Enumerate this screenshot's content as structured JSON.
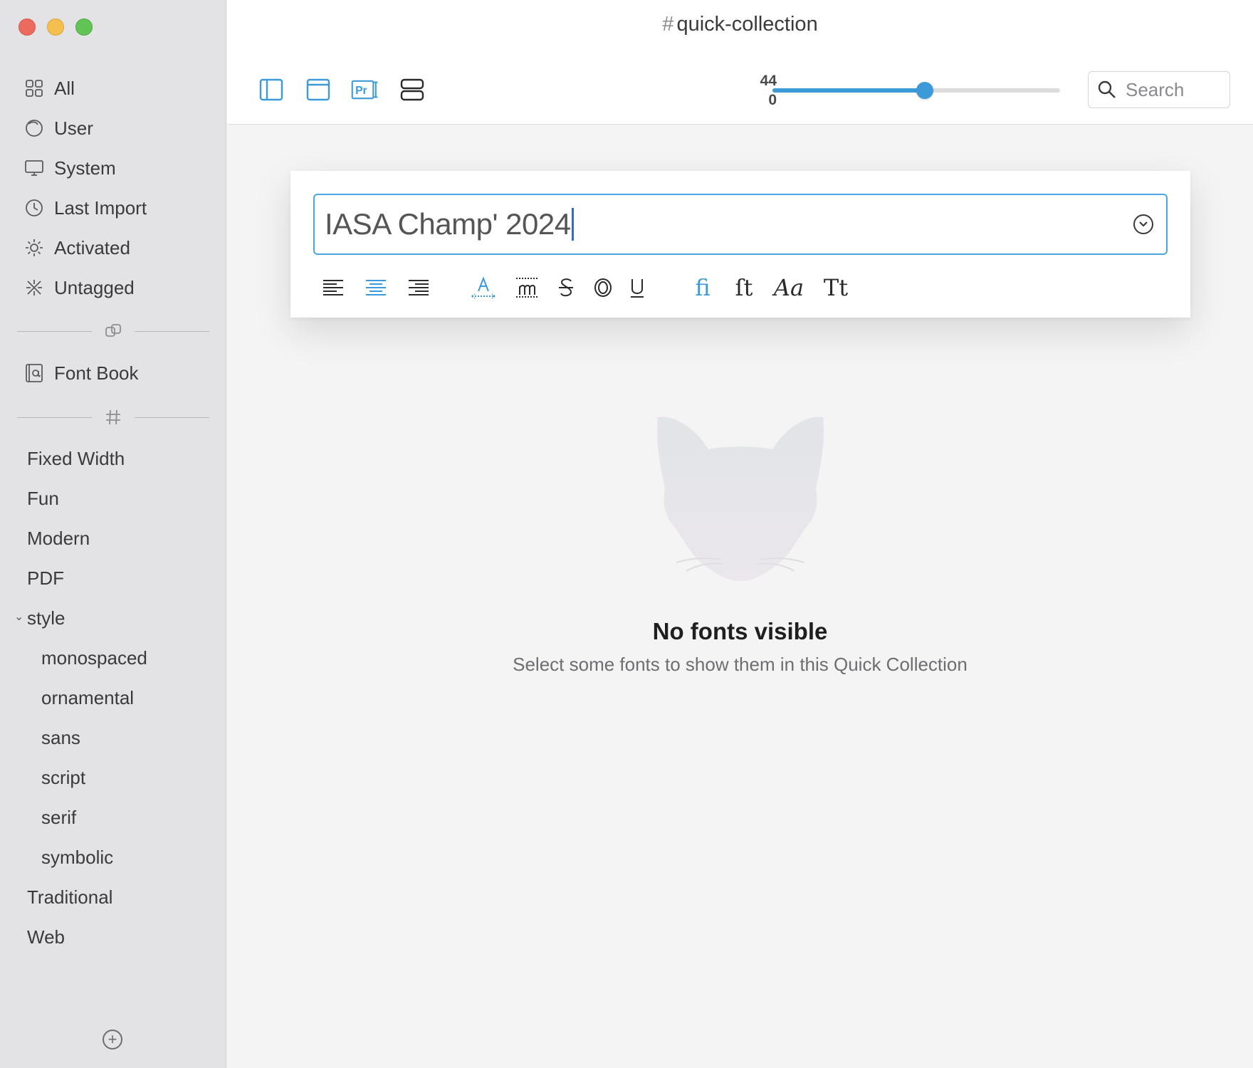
{
  "window": {
    "title": "quick-collection",
    "title_prefix": "#"
  },
  "sidebar": {
    "library": [
      {
        "label": "All",
        "icon": "grid-icon"
      },
      {
        "label": "User",
        "icon": "user-library-icon"
      },
      {
        "label": "System",
        "icon": "display-icon"
      },
      {
        "label": "Last Import",
        "icon": "clock-icon"
      },
      {
        "label": "Activated",
        "icon": "sun-icon"
      },
      {
        "label": "Untagged",
        "icon": "untagged-icon"
      }
    ],
    "font_book": {
      "label": "Font Book",
      "icon": "font-book-icon"
    },
    "tags": [
      {
        "label": "Fixed Width"
      },
      {
        "label": "Fun"
      },
      {
        "label": "Modern"
      },
      {
        "label": "PDF"
      },
      {
        "label": "style",
        "expanded": true
      },
      {
        "label": "monospaced",
        "child": true
      },
      {
        "label": "ornamental",
        "child": true
      },
      {
        "label": "sans",
        "child": true
      },
      {
        "label": "script",
        "child": true
      },
      {
        "label": "serif",
        "child": true
      },
      {
        "label": "symbolic",
        "child": true
      },
      {
        "label": "Traditional"
      },
      {
        "label": "Web"
      }
    ]
  },
  "toolbar": {
    "size_value_top": "44",
    "size_value_bottom": "0",
    "size_slider_fraction": 0.53,
    "search_placeholder": "Search",
    "accent_color": "#3d9ad8"
  },
  "preview": {
    "sample_text": "IASA Champ' 2024",
    "alignment": "center",
    "ligatures_active": true,
    "format_glyphs": {
      "ligature": "fi",
      "discretionary": "ſt",
      "swash": "Aa",
      "case": "Tt"
    }
  },
  "empty_state": {
    "title": "No fonts visible",
    "subtitle": "Select some fonts to show them in this Quick Collection"
  }
}
